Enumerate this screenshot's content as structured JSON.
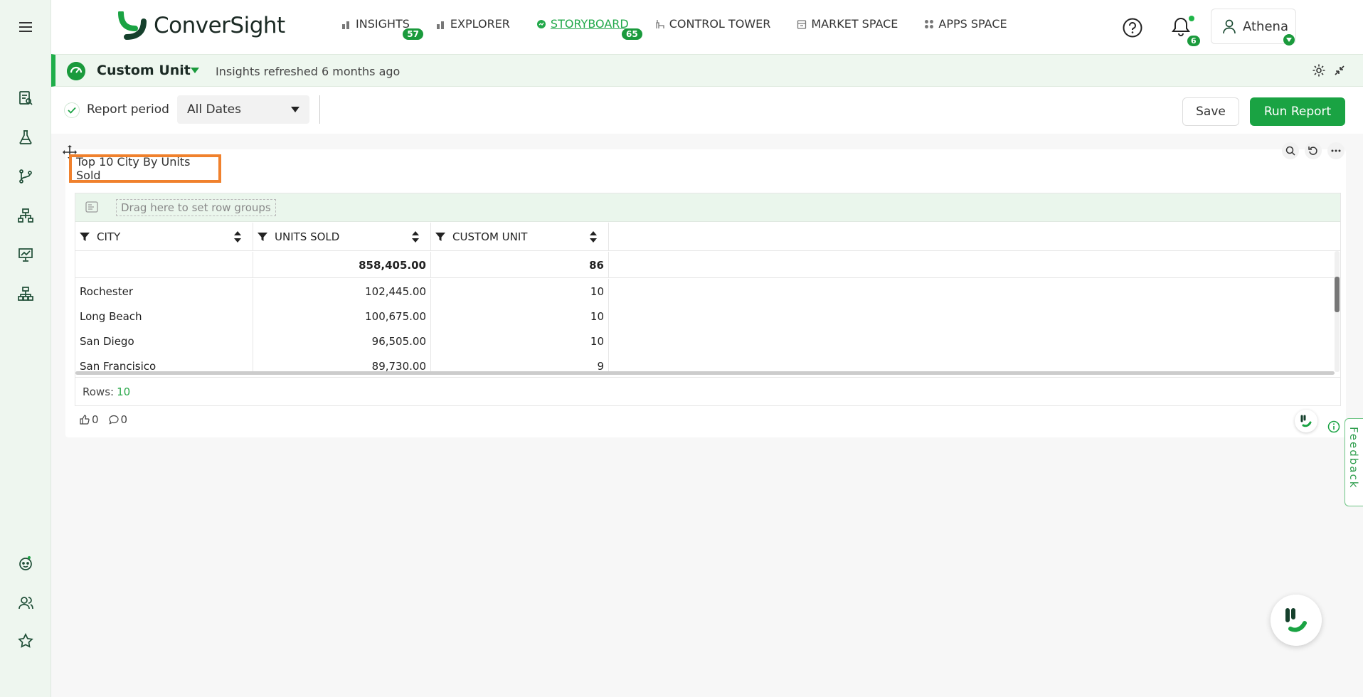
{
  "app": {
    "logo_text": "ConverSight",
    "brand_color": "#1aa343"
  },
  "nav": {
    "items": [
      {
        "label": "INSIGHTS",
        "badge": "57",
        "icon": "bar-chart-icon"
      },
      {
        "label": "EXPLORER",
        "badge": "",
        "icon": "bar-chart-icon"
      },
      {
        "label": "STORYBOARD",
        "badge": "65",
        "icon": "storyboard-icon"
      },
      {
        "label": "CONTROL TOWER",
        "badge": "",
        "icon": "tower-icon"
      },
      {
        "label": "MARKET SPACE",
        "badge": "",
        "icon": "store-icon"
      },
      {
        "label": "APPS SPACE",
        "badge": "",
        "icon": "apps-grid-icon"
      }
    ],
    "active_index": 2,
    "notifications_count": "6",
    "user_name": "Athena"
  },
  "unit_bar": {
    "title": "Custom Unit",
    "refresh_text": "Insights refreshed 6 months ago"
  },
  "toolbar": {
    "report_period_label": "Report period",
    "date_value": "All Dates",
    "save_label": "Save",
    "run_label": "Run Report"
  },
  "card": {
    "title": "Top 10 City By Units Sold",
    "group_hint": "Drag here to set row groups",
    "columns": [
      "City",
      "Units Sold",
      "Custom Unit"
    ],
    "totals": {
      "units_sold": "858,405.00",
      "custom_unit": "86"
    },
    "rows": [
      {
        "city": "Rochester",
        "units_sold": "102,445.00",
        "custom_unit": "10"
      },
      {
        "city": "Long Beach",
        "units_sold": "100,675.00",
        "custom_unit": "10"
      },
      {
        "city": "San Diego",
        "units_sold": "96,505.00",
        "custom_unit": "10"
      },
      {
        "city": "San Francisico",
        "units_sold": "89,730.00",
        "custom_unit": "9"
      }
    ],
    "rows_label": "Rows:",
    "rows_count": "10",
    "likes": "0",
    "comments": "0"
  },
  "feedback_label": "Feedback"
}
